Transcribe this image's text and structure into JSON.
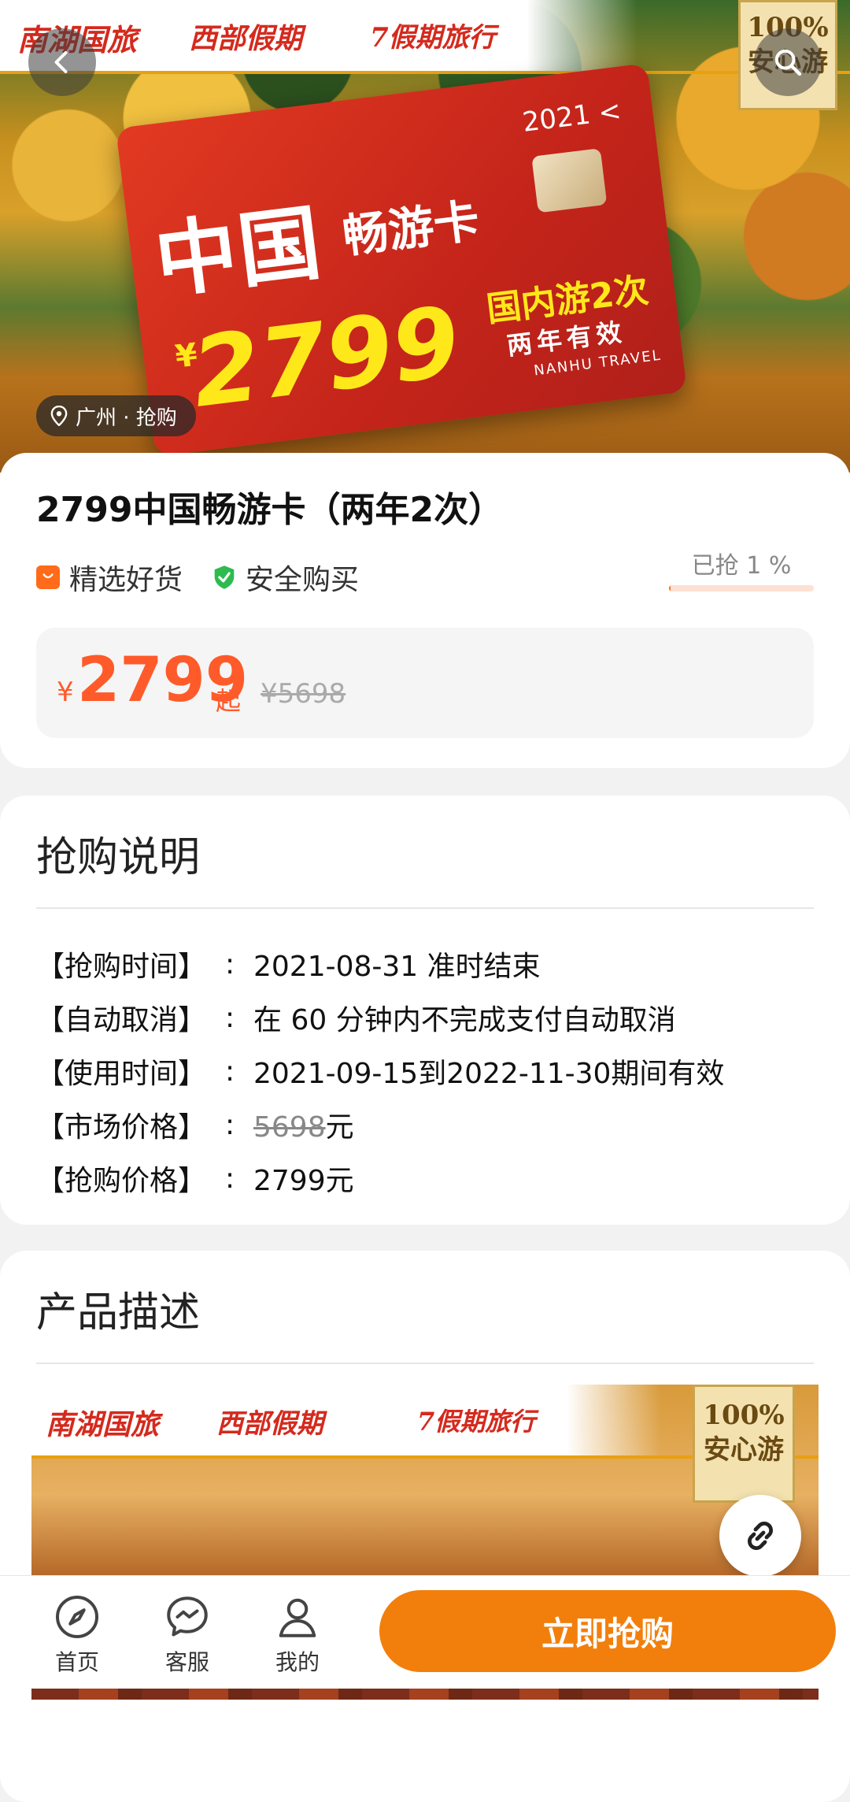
{
  "hero": {
    "logos": [
      "南湖国旅",
      "西部假期",
      "7假期旅行"
    ],
    "badge_line1": "100%",
    "badge_line2": "安心游",
    "card": {
      "year": "2021 <",
      "title": "中国",
      "subtitle": "畅游卡",
      "currency": "¥",
      "price": "2799",
      "note1": "国内游2次",
      "note2": "两年有效",
      "brand": "NANHU TRAVEL"
    },
    "location": "广州 · 抢购"
  },
  "product": {
    "title": "2799中国畅游卡（两年2次）",
    "tags": [
      "精选好货",
      "安全购买"
    ],
    "sold_text": "已抢 1 %",
    "sold_percent": 1,
    "currency": "¥",
    "price": "2799",
    "price_suffix": "起",
    "original_price": "¥5698"
  },
  "purchase_info": {
    "title": "抢购说明",
    "rows": [
      {
        "label": "【抢购时间】",
        "value": "2021-08-31 准时结束"
      },
      {
        "label": "【自动取消】",
        "value": "在 60 分钟内不完成支付自动取消"
      },
      {
        "label": "【使用时间】",
        "value": "2021-09-15到2022-11-30期间有效"
      },
      {
        "label": "【市场价格】",
        "value_strike": "5698",
        "value_suffix": "元"
      },
      {
        "label": "【抢购价格】",
        "value": "2799元"
      }
    ]
  },
  "description": {
    "title": "产品描述",
    "logos": [
      "南湖国旅",
      "西部假期",
      "7假期旅行"
    ],
    "badge_line1": "100%",
    "badge_line2": "安心游"
  },
  "bottom_nav": {
    "items": [
      {
        "label": "首页",
        "icon": "compass-icon"
      },
      {
        "label": "客服",
        "icon": "chat-icon"
      },
      {
        "label": "我的",
        "icon": "user-icon"
      }
    ],
    "buy_label": "立即抢购"
  },
  "colors": {
    "accent": "#f27f0c",
    "price": "#ff5a2a",
    "safe_green": "#2dbb4f"
  }
}
